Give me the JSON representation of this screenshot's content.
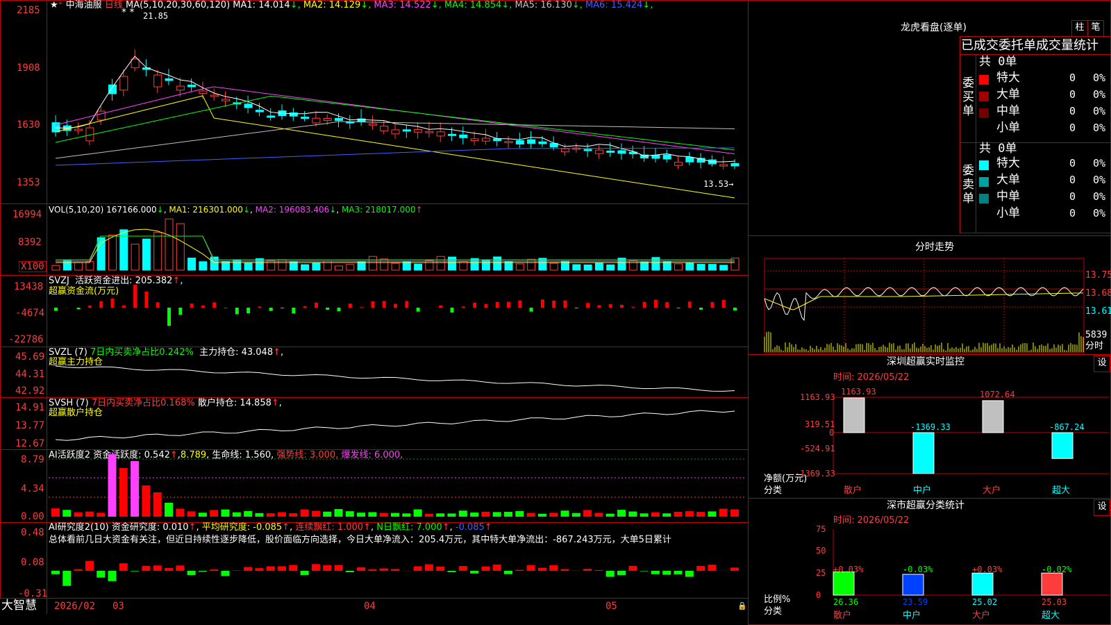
{
  "left": {
    "main": {
      "name": "中海油服",
      "period": "日线",
      "ma_title": "MA(5,10,20,30,60,120)",
      "ma": [
        {
          "label": "MA1:",
          "value": "14.014",
          "arrow": "↓",
          "color": "#ffffff"
        },
        {
          "label": "MA2:",
          "value": "14.129",
          "arrow": "↓",
          "color": "#ffff00"
        },
        {
          "label": "MA3:",
          "value": "14.522",
          "arrow": "↓",
          "color": "#ff40ff"
        },
        {
          "label": "MA4:",
          "value": "14.854",
          "arrow": "↓",
          "color": "#00ff00"
        },
        {
          "label": "MA5:",
          "value": "16.130",
          "arrow": "↓",
          "color": "#c0c0c0"
        },
        {
          "label": "MA6:",
          "value": "15.424",
          "arrow": "↓",
          "color": "#4060ff"
        }
      ],
      "yticks": [
        "2185",
        "1908",
        "1630",
        "1353"
      ],
      "high_label": "21.85",
      "last_label": "13.53"
    },
    "vol": {
      "title": "VOL(5,10,20)",
      "value": "167166.000",
      "ma1": "MA1: 216301.000",
      "ma2": "MA2: 196083.406",
      "ma3": "MA3: 218017.000",
      "yticks": [
        "16994",
        "8392"
      ],
      "unit": "X100"
    },
    "svzj": {
      "title": "SVZJ",
      "label": "活跃资金进出: 205.382",
      "sub": "超赢资金流(万元)",
      "yticks": [
        "13438",
        "-4674",
        "-22786"
      ]
    },
    "svzl": {
      "title": "SVZL (7)",
      "label1": "7日内买卖净占比0.242%",
      "label2": "主力持仓: 43.048",
      "sub": "超赢主力持仓",
      "yticks": [
        "45.69",
        "44.31",
        "42.92"
      ]
    },
    "svsh": {
      "title": "SVSH (7)",
      "label1": "7日内买卖净占比0.168%",
      "label2": "散户持仓: 14.858",
      "sub": "超赢散户持仓",
      "yticks": [
        "14.91",
        "13.77",
        "12.67"
      ]
    },
    "ai1": {
      "title": "AI活跃度2",
      "l1": "资金活跃度: 0.542",
      "l2": "8.789",
      "l3": "生命线: 1.560,",
      "l4": "强势线: 3.000,",
      "l5": "爆发线: 6.000,",
      "yticks": [
        "8.79",
        "4.34",
        "0.00"
      ]
    },
    "ai2": {
      "title": "AI研究度2(10)",
      "l1": "资金研究度: 0.010",
      "l2": "平均研究度: -0.085",
      "l3": "连续飘红: 1.000",
      "l4": "N日飘红: 7.000",
      "l5": "-0.085",
      "yticks": [
        "0.48",
        "0.08",
        "-0.31"
      ],
      "summary": "总体看前几日大资金有关注，但近日持续性逐步降低，股价面临方向选择，今日大单净流入：205.4万元，其中特大单净流出：-867.243万元，大单5日累计"
    },
    "xaxis": {
      "brand": "大智慧",
      "labels": [
        "2026/02",
        "03",
        "04",
        "05"
      ]
    }
  },
  "right": {
    "dragon": {
      "title": "龙虎看盘(逐单)",
      "btn1": "柱",
      "btn2": "笔",
      "header": "已成交委托单成交量统计",
      "buy": {
        "label": "委买单",
        "total": "共 0单",
        "rows": [
          {
            "name": "特大",
            "count": "0",
            "pct": "0%",
            "color": "#ff0000"
          },
          {
            "name": "大单",
            "count": "0",
            "pct": "0%",
            "color": "#a00000"
          },
          {
            "name": "中单",
            "count": "0",
            "pct": "0%",
            "color": "#700000"
          },
          {
            "name": "小单",
            "count": "0",
            "pct": "0%",
            "color": "#000000"
          }
        ]
      },
      "sell": {
        "label": "委卖单",
        "total": "共 0单",
        "rows": [
          {
            "name": "特大",
            "count": "0",
            "pct": "0%",
            "color": "#00ffff"
          },
          {
            "name": "大单",
            "count": "0",
            "pct": "0%",
            "color": "#00a0a0"
          },
          {
            "name": "中单",
            "count": "0",
            "pct": "0%",
            "color": "#008080"
          },
          {
            "name": "小单",
            "count": "0",
            "pct": "0%",
            "color": "#000000"
          }
        ]
      }
    },
    "intraday": {
      "title": "分时走势",
      "prices": [
        "13.75",
        "13.68",
        "13.61"
      ],
      "vol": "5839",
      "vol_label": "分时"
    },
    "sz_monitor": {
      "title": "深圳超赢实时监控",
      "btn": "设",
      "time": "时间: 2026/05/22",
      "yticks": [
        "1163.93",
        "319.51",
        "0",
        "-524.91",
        "-1369.33"
      ],
      "ylabel": "净额(万元)",
      "xlabel": "分类",
      "categories": [
        "散户",
        "中户",
        "大户",
        "超大"
      ],
      "values": [
        1163.93,
        -1369.33,
        1072.64,
        -867.24
      ],
      "value_labels": [
        "1163.93",
        "-1369.33",
        "1072.64",
        "-867.24"
      ]
    },
    "sz_class": {
      "title": "深市超赢分类统计",
      "btn": "设",
      "time": "时间: 2026/05/22",
      "yticks": [
        "75",
        "50",
        "25",
        "0"
      ],
      "ylabel": "比例%",
      "xlabel": "分类",
      "categories": [
        "散户",
        "中户",
        "大户",
        "超大"
      ],
      "pct": [
        "26.36",
        "23.59",
        "25.02",
        "25.03"
      ],
      "change": [
        "+0.03%",
        "-0.03%",
        "+0.03%",
        "-0.02%"
      ]
    }
  },
  "chart_data": {
    "type": "bar",
    "title": "深圳超赢实时监控",
    "categories": [
      "散户",
      "中户",
      "大户",
      "超大"
    ],
    "series": [
      {
        "name": "净额(万元)",
        "values": [
          1163.93,
          -1369.33,
          1072.64,
          -867.24
        ]
      }
    ],
    "ylim": [
      -1369.33,
      1163.93
    ]
  }
}
